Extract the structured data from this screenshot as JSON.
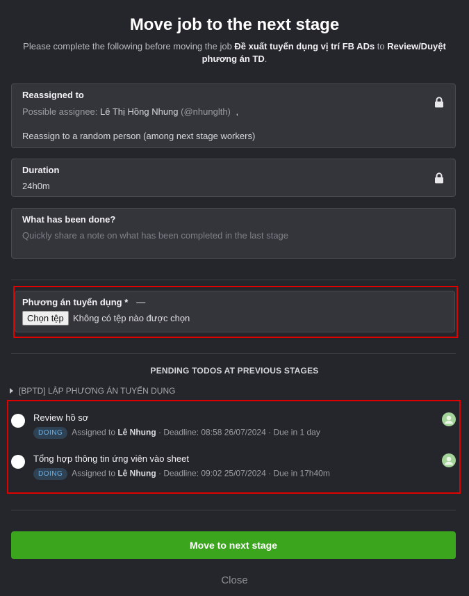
{
  "modal": {
    "title": "Move job to the next stage",
    "subtitle_prefix": "Please complete the following before moving the job ",
    "job_name": "Đề xuất tuyển dụng vị trí FB ADs",
    "subtitle_to": " to ",
    "target_stage": "Review/Duyệt phương án TD",
    "subtitle_suffix": "."
  },
  "reassigned": {
    "label": "Reassigned to",
    "possible_prefix": "Possible assignee: ",
    "assignee_name": "Lê Thị Hồng Nhung",
    "assignee_handle": "(@nhunglth)",
    "separator": ",",
    "random_text": "Reassign to a random person (among next stage workers)",
    "lock_icon": "lock-icon"
  },
  "duration": {
    "label": "Duration",
    "value": "24h0m",
    "lock_icon": "lock-icon"
  },
  "done": {
    "label": "What has been done?",
    "placeholder": "Quickly share a note on what has been completed in the last stage"
  },
  "attachment": {
    "label": "Phương án tuyển dụng *",
    "dash": "—",
    "button_label": "Chọn tệp",
    "status": "Không có tệp nào được chọn"
  },
  "todos_section": {
    "title": "PENDING TODOS AT PREVIOUS STAGES",
    "group_label": "[BPTD] LẬP PHƯƠNG ÁN TUYỂN DỤNG",
    "items": [
      {
        "title": "Review hồ sơ",
        "status": "DOING",
        "assigned_prefix": "Assigned to ",
        "assignee": "Lê Nhung",
        "deadline": " · Deadline: 08:58 26/07/2024 · Due in 1 day"
      },
      {
        "title": "Tổng hợp thông tin ứng viên vào sheet",
        "status": "DOING",
        "assigned_prefix": "Assigned to ",
        "assignee": "Lê Nhung",
        "deadline": " · Deadline: 09:02 25/07/2024 · Due in 17h40m"
      }
    ]
  },
  "actions": {
    "primary": "Move to next stage",
    "close": "Close"
  },
  "colors": {
    "background": "#25262b",
    "card": "#34353b",
    "primary_button": "#3aa51d",
    "highlight": "#e00000",
    "badge_text": "#6fb3e6",
    "avatar": "#a5d49a"
  }
}
